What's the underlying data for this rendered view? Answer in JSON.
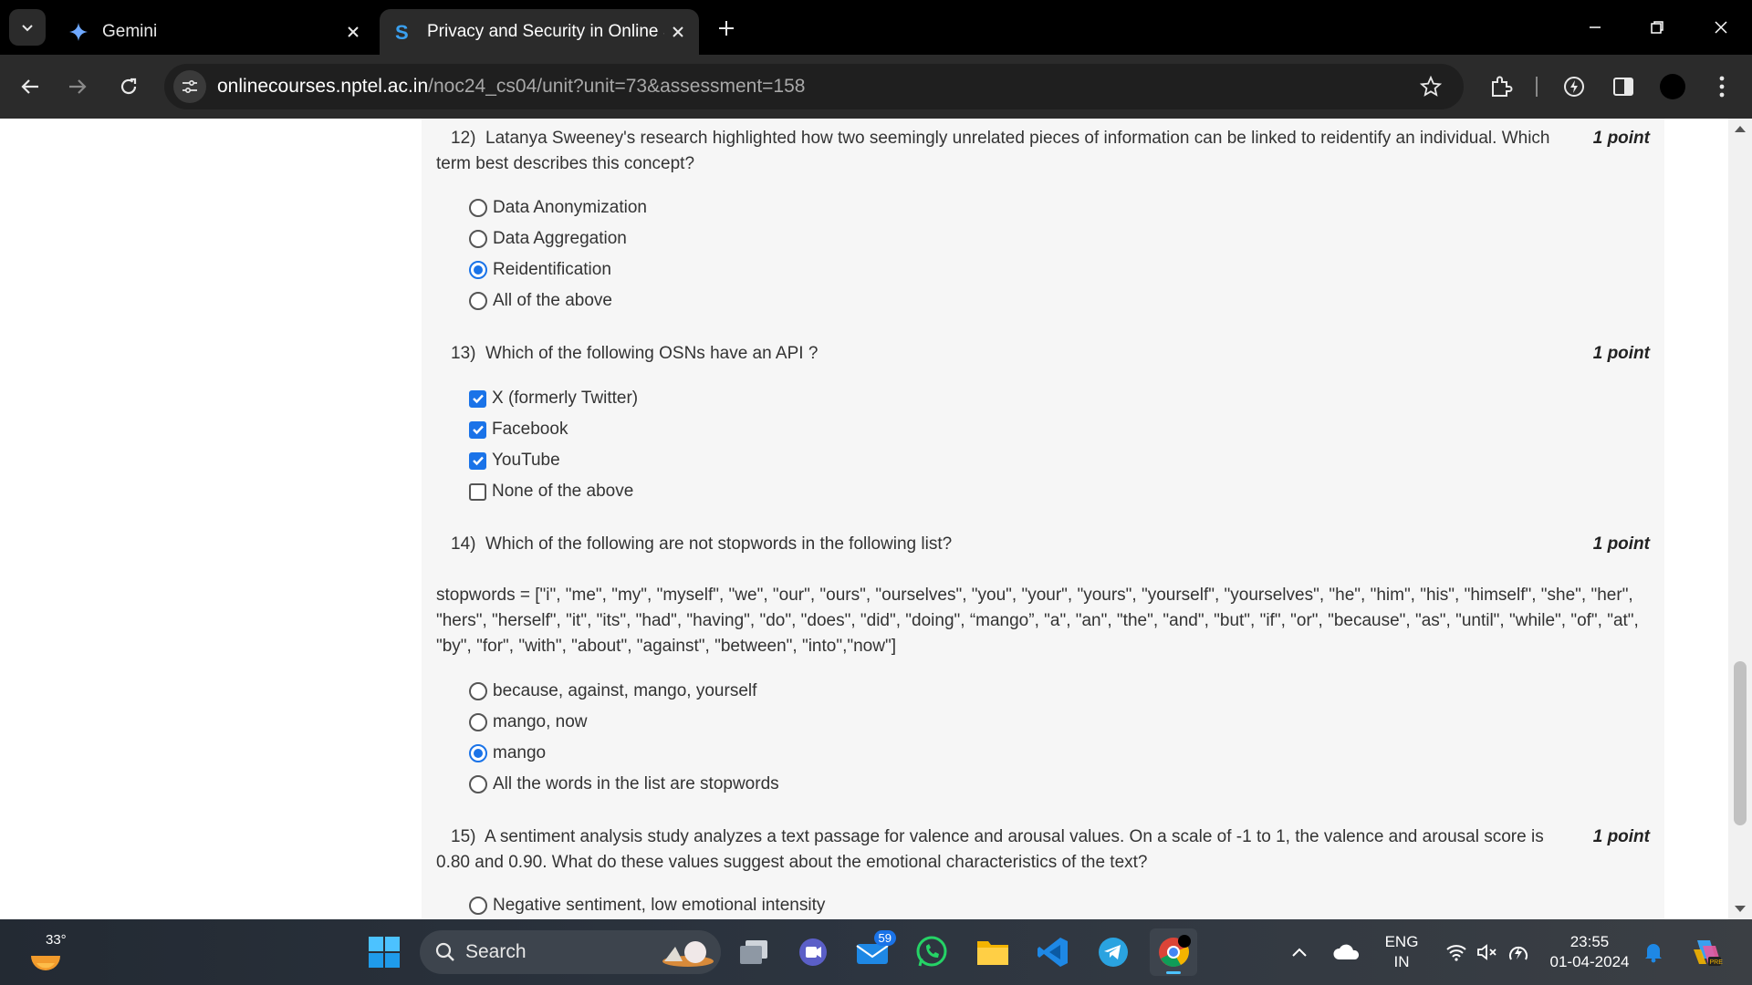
{
  "browser": {
    "tabs": [
      {
        "title": "Gemini",
        "icon": "gemini-sparkle-icon",
        "active": false
      },
      {
        "title": "Privacy and Security in Online S",
        "icon": "swayam-s-icon",
        "active": true
      }
    ],
    "url_domain": "onlinecourses.nptel.ac.in",
    "url_path": "/noc24_cs04/unit?unit=73&assessment=158"
  },
  "questions": [
    {
      "number": "12)",
      "text": "Latanya Sweeney's research highlighted how two seemingly unrelated pieces of information can be linked to reidentify an individual. Which term best describes this concept?",
      "points": "1 point",
      "type": "radio",
      "options": [
        {
          "label": "Data Anonymization",
          "checked": false
        },
        {
          "label": "Data Aggregation",
          "checked": false
        },
        {
          "label": "Reidentification",
          "checked": true
        },
        {
          "label": "All of the above",
          "checked": false
        }
      ]
    },
    {
      "number": "13)",
      "text": "Which of the following OSNs have an API ?",
      "points": "1 point",
      "type": "checkbox",
      "options": [
        {
          "label": "X (formerly Twitter)",
          "checked": true
        },
        {
          "label": "Facebook",
          "checked": true
        },
        {
          "label": "YouTube",
          "checked": true
        },
        {
          "label": "None of the above",
          "checked": false
        }
      ]
    },
    {
      "number": "14)",
      "text": "Which of the following are not stopwords in the following list?",
      "points": "1 point",
      "type": "radio",
      "body": "stopwords = [\"i\", \"me\", \"my\", \"myself\", \"we\", \"our\", \"ours\", \"ourselves\", \"you\", \"your\", \"yours\", \"yourself\", \"yourselves\", \"he\", \"him\", \"his\", \"himself\", \"she\", \"her\", \"hers\", \"herself\", \"it\", \"its\", \"had\", \"having\", \"do\", \"does\", \"did\", \"doing\", “mango”, \"a\", \"an\", \"the\", \"and\", \"but\", \"if\", \"or\", \"because\", \"as\", \"until\", \"while\", \"of\", \"at\", \"by\", \"for\", \"with\", \"about\", \"against\", \"between\", \"into\",\"now\"]",
      "options": [
        {
          "label": "because, against, mango, yourself",
          "checked": false
        },
        {
          "label": "mango, now",
          "checked": false
        },
        {
          "label": "mango",
          "checked": true
        },
        {
          "label": "All the words in the list are stopwords",
          "checked": false
        }
      ]
    },
    {
      "number": "15)",
      "text": "A sentiment analysis study analyzes a text passage for valence and arousal values. On a scale of -1 to 1, the valence and arousal score is 0.80 and 0.90. What do these values suggest about the emotional characteristics of the text?",
      "points": "1 point",
      "type": "radio",
      "options": [
        {
          "label": "Negative sentiment, low emotional intensity",
          "checked": false
        }
      ]
    }
  ],
  "taskbar": {
    "weather_temp": "33°",
    "search_label": "Search",
    "mail_badge": "59",
    "language_top": "ENG",
    "language_bottom": "IN",
    "time": "23:55",
    "date": "01-04-2024"
  },
  "colors": {
    "accent": "#1a73e8",
    "tab_bar": "#000000",
    "toolbar": "#2b2b2b",
    "assessment_bg": "#f6f6f6"
  }
}
